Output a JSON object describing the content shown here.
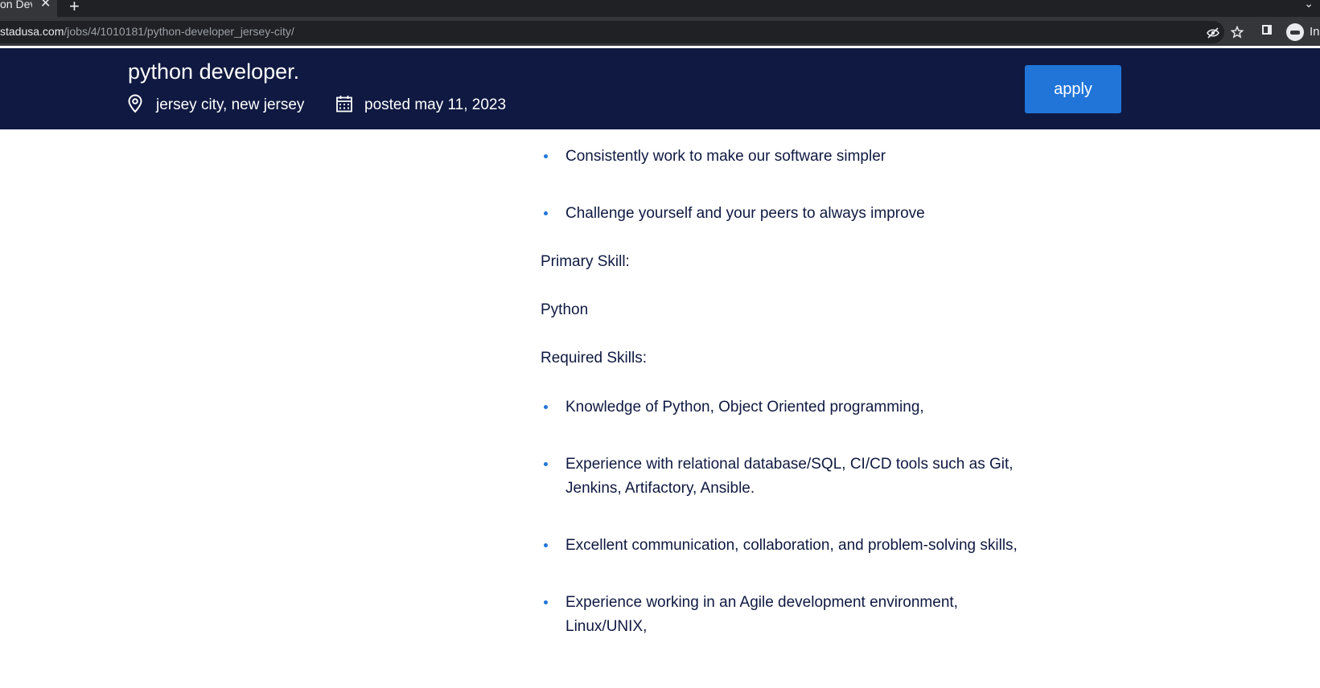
{
  "browser": {
    "tab_title": "on Dev",
    "url_host": "stadusa.com",
    "url_path": "/jobs/4/1010181/python-developer_jersey-city/",
    "profile_label": "In"
  },
  "job": {
    "title": "python developer.",
    "location": "jersey city,  new jersey",
    "posted": "posted may 11, 2023",
    "apply_label": "apply",
    "brand_color": "#0f1941",
    "accent_color": "#2175d9"
  },
  "content": {
    "top_bullets": [
      "Consistently work to make our software simpler",
      "Challenge yourself and your peers to always improve"
    ],
    "primary_skill_label": "Primary Skill:",
    "primary_skill_value": "Python",
    "required_skills_label": "Required Skills:",
    "required_skills": [
      "Knowledge of Python, Object Oriented programming,",
      "Experience with relational database/SQL, CI/CD tools such as Git, Jenkins, Artifactory, Ansible.",
      "Excellent communication, collaboration, and problem-solving skills,",
      "Experience working in an Agile development environment, Linux/UNIX,"
    ]
  }
}
